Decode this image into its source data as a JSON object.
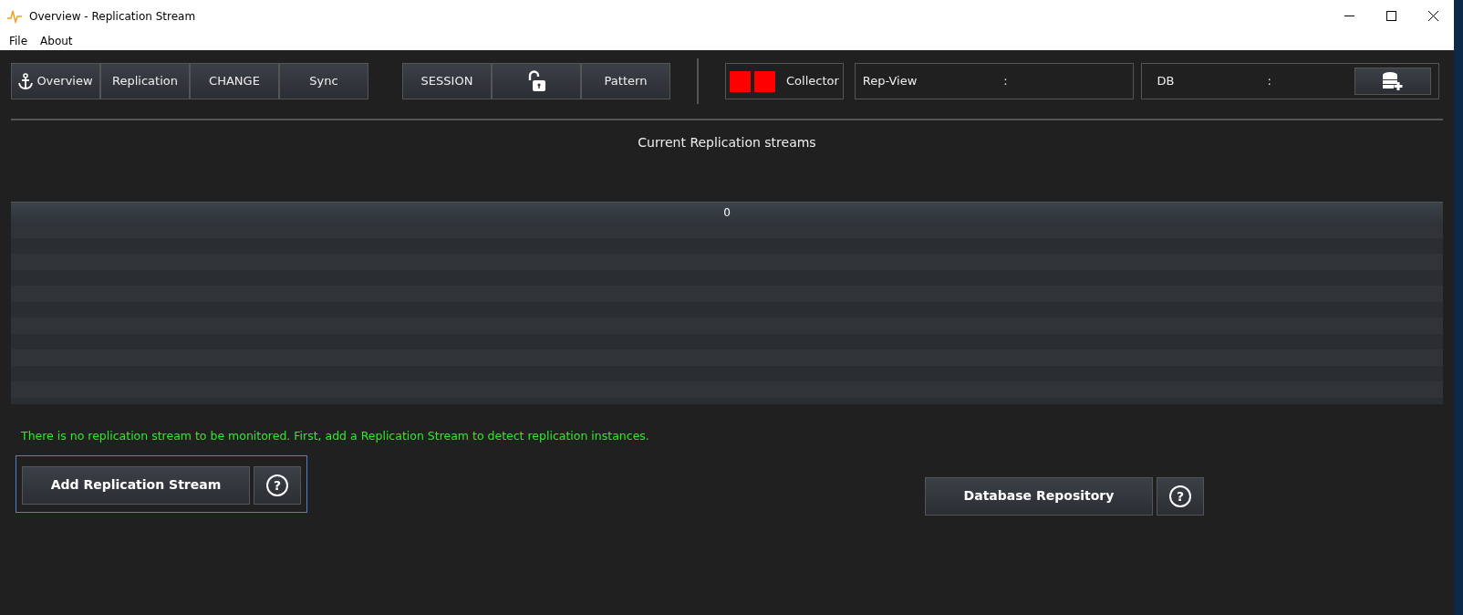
{
  "window": {
    "title": "Overview - Replication Stream"
  },
  "menu": [
    "File",
    "About"
  ],
  "nav_tabs": [
    {
      "label": "Overview",
      "kind": "anchor"
    },
    {
      "label": "Replication",
      "kind": "text"
    },
    {
      "label": "CHANGE",
      "kind": "text"
    },
    {
      "label": "Sync",
      "kind": "text"
    }
  ],
  "session_tabs": [
    {
      "label": "SESSION",
      "kind": "text"
    },
    {
      "kind": "lock"
    },
    {
      "label": "Pattern",
      "kind": "text"
    }
  ],
  "collector": {
    "indicators": [
      {
        "color": "#ff0000"
      },
      {
        "color": "#ff0000"
      }
    ],
    "label": "Collector"
  },
  "rep_view": {
    "label": "Rep-View",
    "separator": ":"
  },
  "db": {
    "label": "DB",
    "separator": ":"
  },
  "section_title": "Current Replication streams",
  "table": {
    "columns": [
      "0"
    ]
  },
  "message": "There is no replication stream to be monitored. First, add a Replication Stream to detect replication instances.",
  "add_button": "Add Replication Stream",
  "add_help": "?",
  "repository_button": "Database Repository",
  "repository_help": "?"
}
